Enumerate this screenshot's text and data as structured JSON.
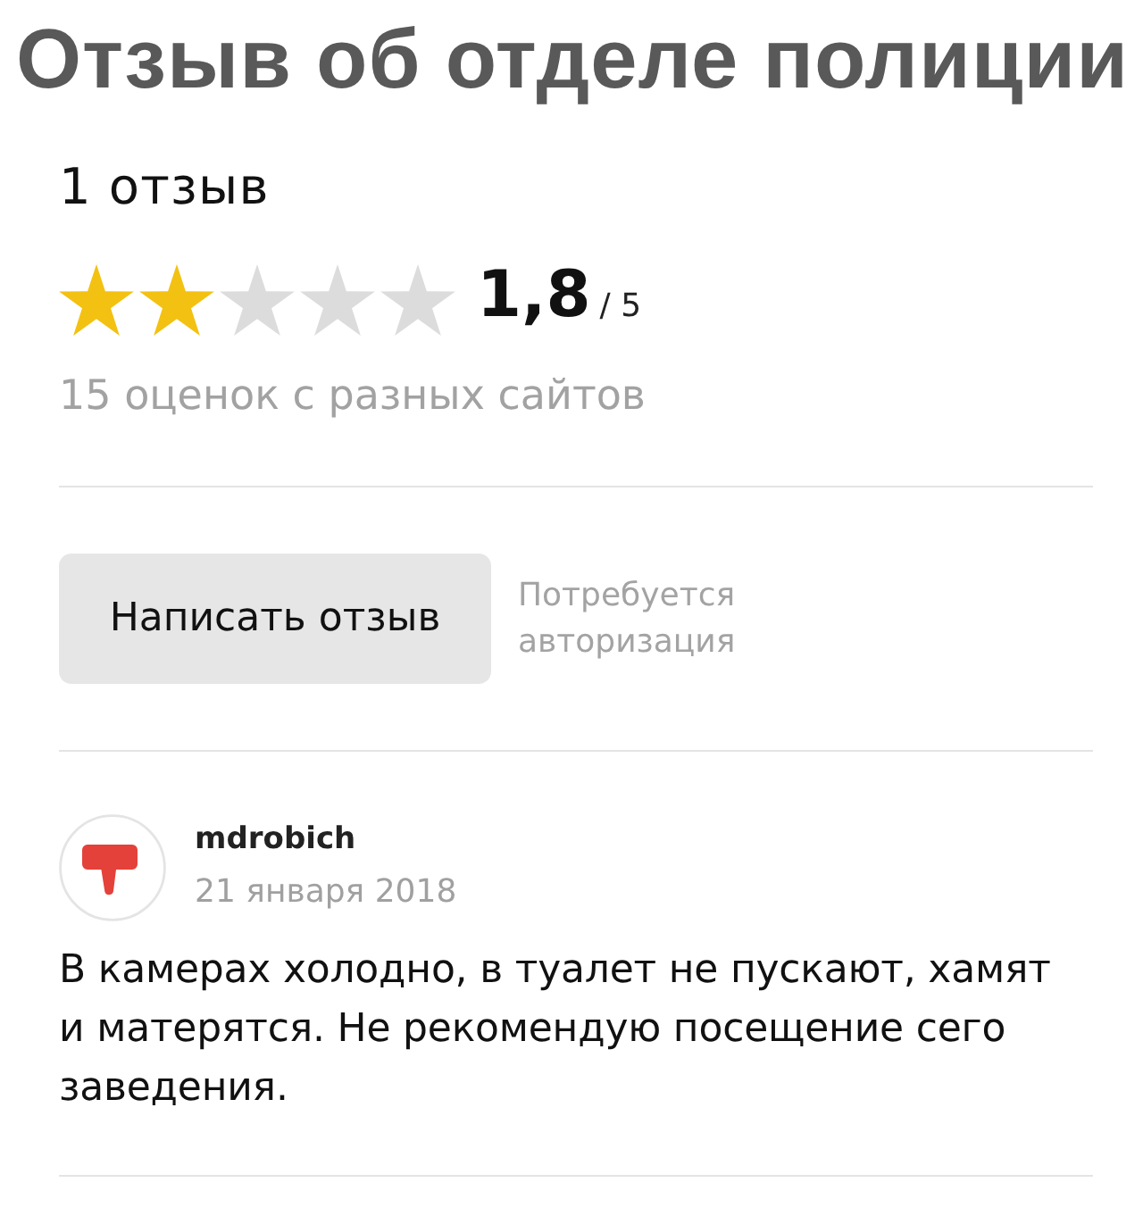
{
  "title": "Отзыв об отделе полиции",
  "summary": {
    "review_count": "1 отзыв",
    "stars": 2,
    "rating": "1,8",
    "scale": "/ 5",
    "ratings_note": "15 оценок с разных сайтов"
  },
  "write_review": {
    "button": "Написать отзыв",
    "note": "Потребуется авторизация"
  },
  "reviews": [
    {
      "author": "mdrobich",
      "date": "21 января 2018",
      "text": "В камерах холодно, в туалет не пускают, хамят и матерятся. Не рекомендую посещение сего заведения."
    }
  ]
}
